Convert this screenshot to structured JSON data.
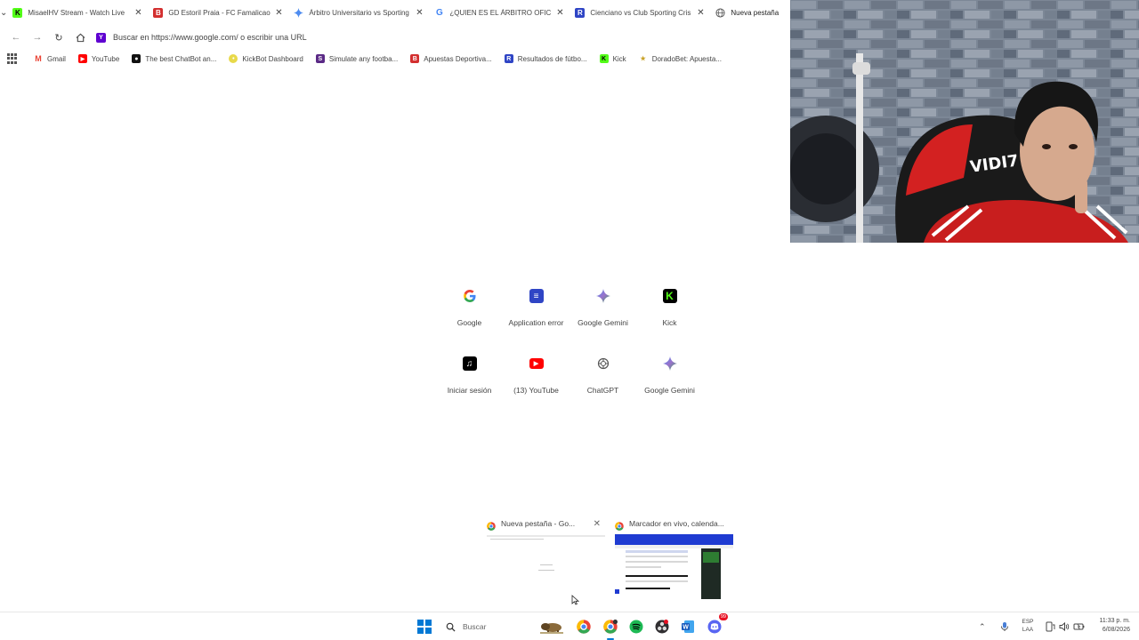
{
  "tabs": [
    {
      "title": "MisaelHV Stream - Watch Live",
      "favicon": "kick-icon",
      "close": "✕"
    },
    {
      "title": "GD Estoril Praia - FC Famalicao",
      "favicon": "apuestas-icon",
      "close": "✕"
    },
    {
      "title": "Árbitro Universitario vs Sporting",
      "favicon": "gemini-icon",
      "close": "✕"
    },
    {
      "title": "¿QUIEN ES EL ÁRBITRO OFICIAL",
      "favicon": "google-icon",
      "close": "✕"
    },
    {
      "title": "Cienciano vs Club Sporting Cris",
      "favicon": "resultados-icon",
      "close": "✕"
    },
    {
      "title": "Nueva pestaña",
      "favicon": "globe-icon",
      "close": ""
    }
  ],
  "toolbar": {
    "omnibox_text": "Buscar en https://www.google.com/ o escribir una URL"
  },
  "bookmarks": [
    {
      "label": "Gmail",
      "icon": "gmail-icon",
      "color": "#ea4335"
    },
    {
      "label": "YouTube",
      "icon": "youtube-icon",
      "color": "#ff0000"
    },
    {
      "label": "The best ChatBot an...",
      "icon": "chatbot-icon",
      "color": "#111111"
    },
    {
      "label": "KickBot Dashboard",
      "icon": "kickbot-icon",
      "color": "#e8d94a"
    },
    {
      "label": "Simulate any footba...",
      "icon": "simulate-icon",
      "color": "#5b2a86"
    },
    {
      "label": "Apuestas Deportiva...",
      "icon": "apuestas-icon",
      "color": "#d32f2f"
    },
    {
      "label": "Resultados de fútbo...",
      "icon": "resultados-icon",
      "color": "#2f45c5"
    },
    {
      "label": "Kick",
      "icon": "kick-icon",
      "color": "#53fc18"
    },
    {
      "label": "DoradoBet: Apuesta...",
      "icon": "doradobet-icon",
      "color": "#c9a227"
    }
  ],
  "shortcuts": [
    {
      "label": "Google",
      "icon": "google-icon"
    },
    {
      "label": "Application error",
      "icon": "application-error-icon"
    },
    {
      "label": "Google Gemini",
      "icon": "gemini-icon"
    },
    {
      "label": "Kick",
      "icon": "kick-icon"
    },
    {
      "label": "Iniciar sesión",
      "icon": "tiktok-icon"
    },
    {
      "label": "(13) YouTube",
      "icon": "youtube-icon"
    },
    {
      "label": "ChatGPT",
      "icon": "chatgpt-icon"
    },
    {
      "label": "Google Gemini",
      "icon": "gemini-icon"
    }
  ],
  "previews": [
    {
      "title": "Nueva pestaña - Go...",
      "close": "✕"
    },
    {
      "title": "Marcador en vivo, calenda...",
      "close": ""
    }
  ],
  "taskbar": {
    "search_placeholder": "Buscar",
    "lang_line1": "ESP",
    "lang_line2": "LAA",
    "time": "11:33 p. m.",
    "date": "6/08/2026",
    "apps": [
      "chrome-icon",
      "chrome-profile-icon",
      "spotify-icon",
      "obs-icon",
      "word-icon",
      "discord-icon"
    ],
    "notification_count": "99"
  },
  "webcam": {
    "shirt_text": "VIDI7"
  }
}
